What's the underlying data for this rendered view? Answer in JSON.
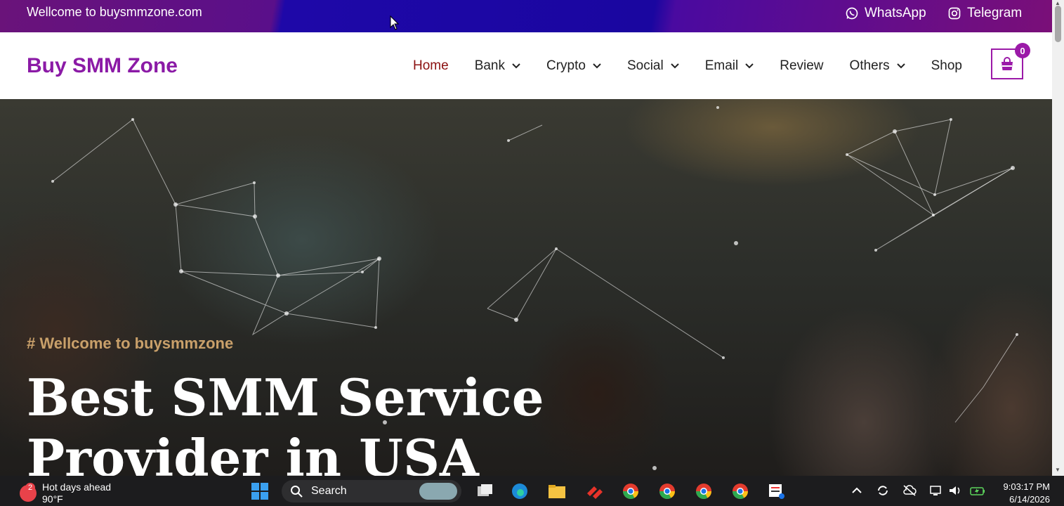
{
  "topbar": {
    "welcome": "Wellcome to buysmmzone.com",
    "whatsapp_label": "WhatsApp",
    "telegram_label": "Telegram"
  },
  "header": {
    "logo": "Buy SMM Zone",
    "nav": [
      {
        "label": "Home",
        "active": true,
        "dropdown": false
      },
      {
        "label": "Bank",
        "dropdown": true
      },
      {
        "label": "Crypto",
        "dropdown": true
      },
      {
        "label": "Social",
        "dropdown": true
      },
      {
        "label": "Email",
        "dropdown": true
      },
      {
        "label": "Review",
        "dropdown": false
      },
      {
        "label": "Others",
        "dropdown": true
      },
      {
        "label": "Shop",
        "dropdown": false
      }
    ],
    "cart_count": "0"
  },
  "hero": {
    "subtitle": "# Wellcome to buysmmzone",
    "title": "Best SMM Service Provider in USA"
  },
  "taskbar": {
    "weather_badge": "2",
    "weather_title": "Hot days ahead",
    "weather_temp": "90°F",
    "search_label": "Search",
    "time": "9:03:17 PM",
    "date": "6/14/2026"
  },
  "colors": {
    "brand": "#8b1aa6",
    "active_nav": "#8b1010",
    "hero_subtitle": "#c9a06a"
  }
}
